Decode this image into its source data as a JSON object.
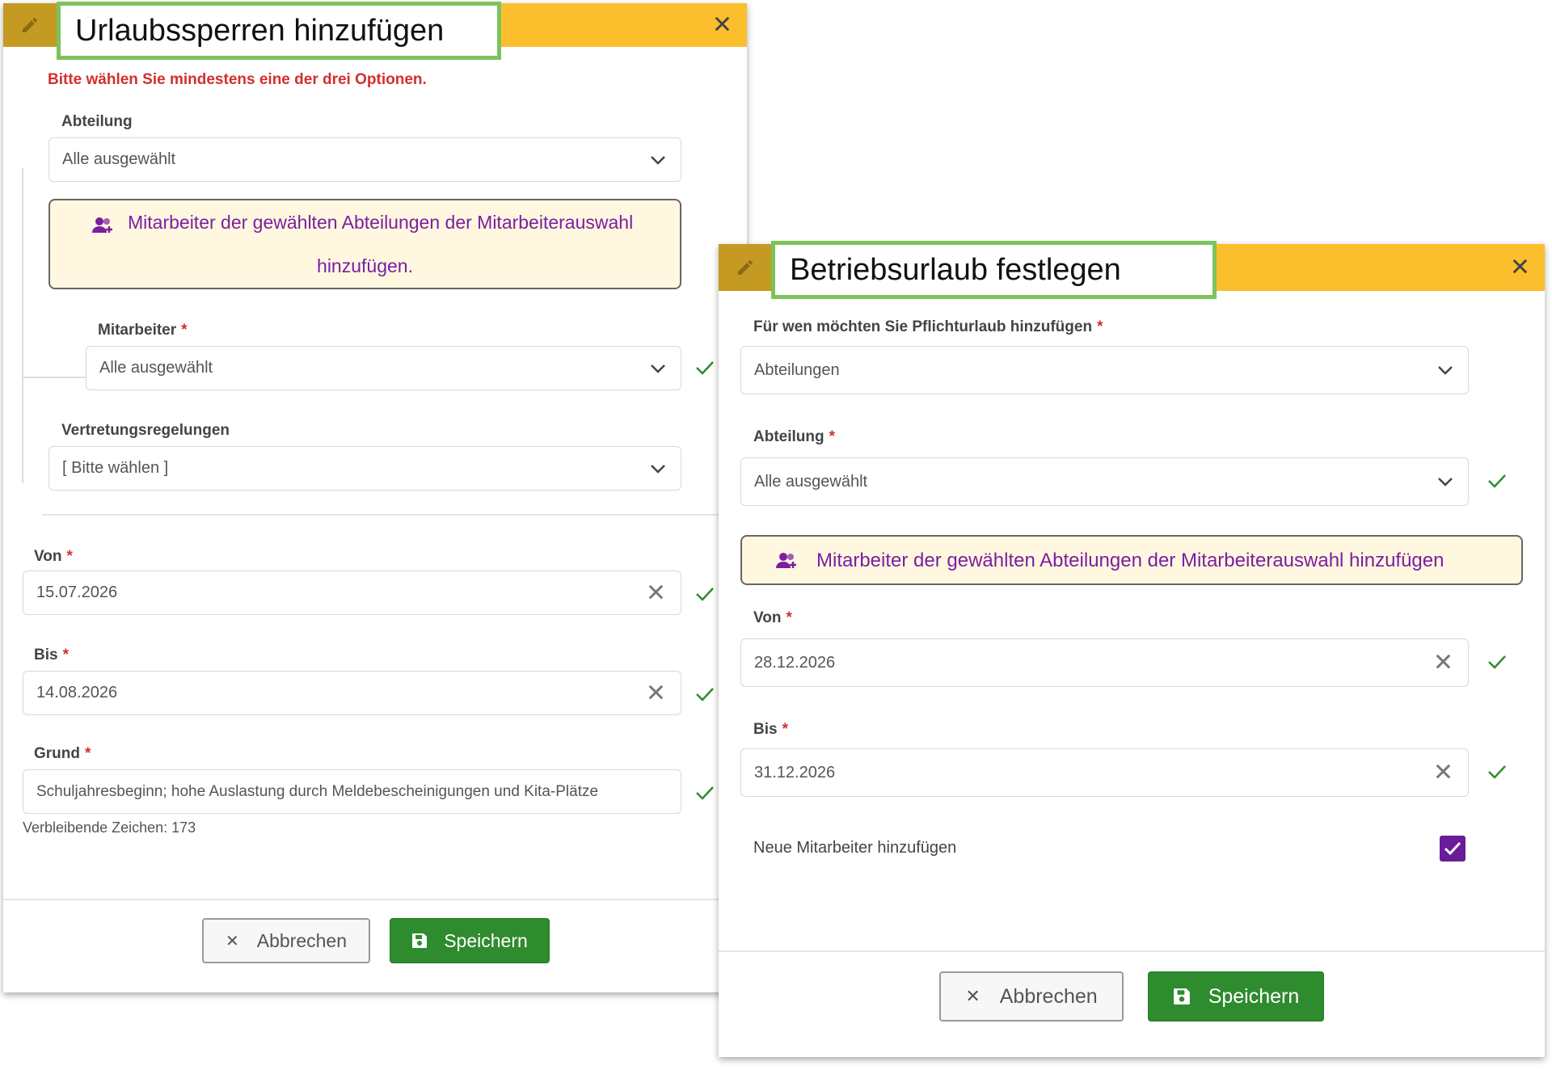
{
  "dialog1": {
    "title": "Urlaubssperren hinzufügen",
    "error": "Bitte wählen Sie mindestens eine der drei Optionen.",
    "abteilung": {
      "label": "Abteilung",
      "value": "Alle ausgewählt"
    },
    "add_employees_line1": "Mitarbeiter der gewählten Abteilungen der Mitarbeiterauswahl",
    "add_employees_line2": "hinzufügen.",
    "mitarbeiter": {
      "label": "Mitarbeiter",
      "value": "Alle ausgewählt"
    },
    "vertretung": {
      "label": "Vertretungsregelungen",
      "value": "[ Bitte wählen ]"
    },
    "von": {
      "label": "Von",
      "value": "15.07.2026"
    },
    "bis": {
      "label": "Bis",
      "value": "14.08.2026"
    },
    "grund": {
      "label": "Grund",
      "value": "Schuljahresbeginn; hohe Auslastung durch Meldebescheinigungen und Kita-Plätze"
    },
    "remaining": "Verbleibende Zeichen: 173",
    "cancel_label": "Abbrechen",
    "save_label": "Speichern"
  },
  "dialog2": {
    "title": "Betriebsurlaub festlegen",
    "target": {
      "label": "Für wen möchten Sie Pflichturlaub hinzufügen",
      "value": "Abteilungen"
    },
    "abteilung": {
      "label": "Abteilung",
      "value": "Alle ausgewählt"
    },
    "add_employees": "Mitarbeiter der gewählten Abteilungen der Mitarbeiterauswahl hinzufügen",
    "von": {
      "label": "Von",
      "value": "28.12.2026"
    },
    "bis": {
      "label": "Bis",
      "value": "31.12.2026"
    },
    "new_employees": {
      "label": "Neue Mitarbeiter hinzufügen",
      "checked": true
    },
    "cancel_label": "Abbrechen",
    "save_label": "Speichern"
  },
  "common": {
    "required_mark": "*",
    "close_glyph": "✕",
    "clear_glyph": "✕"
  },
  "colors": {
    "header": "#fbbf2d",
    "title_border": "#7dc35b",
    "error": "#d32f2f",
    "accent_purple": "#7a1fa2",
    "save_green": "#2e8b2e",
    "check_green": "#2e8b2e"
  },
  "icons": [
    "pencil-icon",
    "close-icon",
    "chevron-down-icon",
    "check-icon",
    "users-add-icon",
    "clear-icon",
    "floppy-icon",
    "checkbox-checked-icon"
  ]
}
